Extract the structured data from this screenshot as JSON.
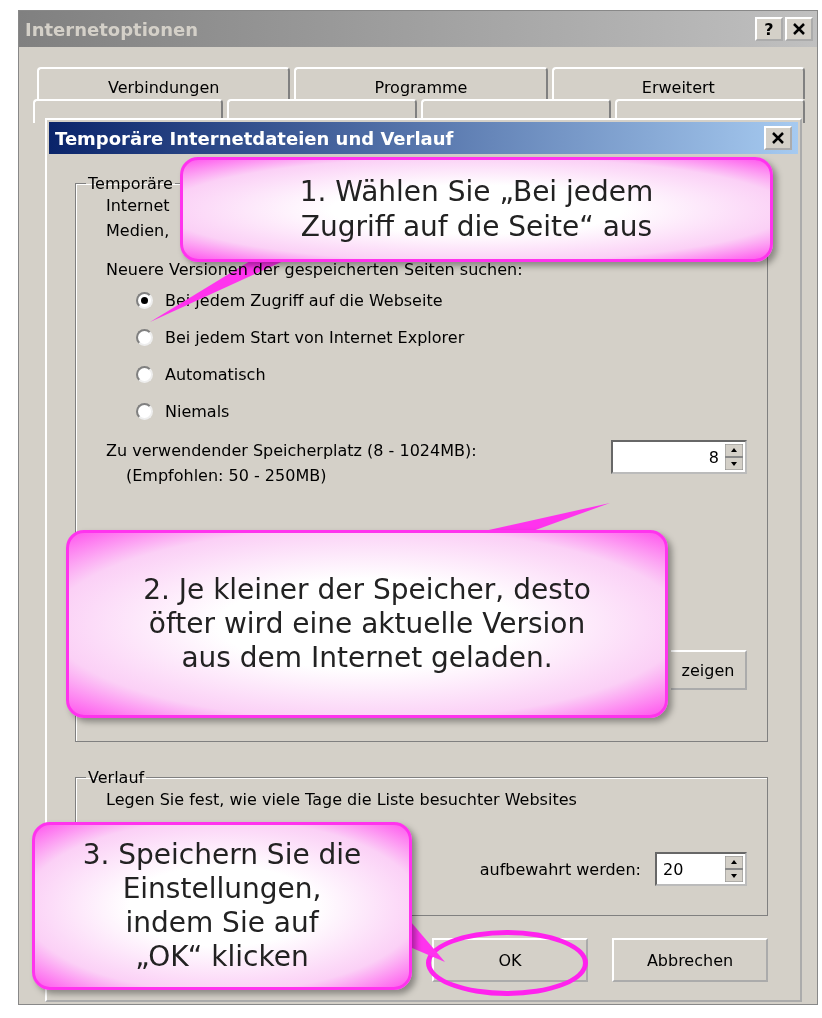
{
  "window": {
    "title": "Internetoptionen",
    "help_button": "?"
  },
  "tabs": [
    {
      "label": "Verbindungen"
    },
    {
      "label": "Programme"
    },
    {
      "label": "Erweitert"
    }
  ],
  "dialog": {
    "title": "Temporäre Internetdateien und Verlauf",
    "cache_group": {
      "legend": "Temporäre",
      "description": [
        "Internet",
        "Medien,"
      ],
      "check_label": "Neuere Versionen der gespeicherten Seiten suchen:",
      "options": [
        {
          "label": "Bei jedem Zugriff auf die Webseite",
          "selected": true
        },
        {
          "label": "Bei jedem Start von Internet Explorer",
          "selected": false
        },
        {
          "label": "Automatisch",
          "selected": false
        },
        {
          "label": "Niemals",
          "selected": false
        }
      ],
      "space_label": "Zu verwendender Speicherplatz (8 - 1024MB):",
      "space_hint": "(Empfohlen: 50 - 250MB)",
      "space_value": "8",
      "button": "zeigen"
    },
    "history_group": {
      "legend": "Verlauf",
      "description": "Legen Sie fest, wie viele Tage die Liste besuchter Websites",
      "days_label": "aufbewahrt werden:",
      "days_value": "20"
    },
    "buttons": [
      {
        "label": "OK",
        "highlighted": true
      },
      {
        "label": "Abbrechen",
        "highlighted": false
      }
    ]
  },
  "callouts": [
    {
      "text": "1. Wählen Sie „Bei jedem\nZugriff auf die Seite“ aus"
    },
    {
      "text": "2. Je kleiner der Speicher, desto\nöfter wird eine aktuelle Version\naus dem Internet geladen."
    },
    {
      "text": "3. Speichern Sie die\nEinstellungen,\nindem Sie auf\n„OK“ klicken"
    }
  ]
}
